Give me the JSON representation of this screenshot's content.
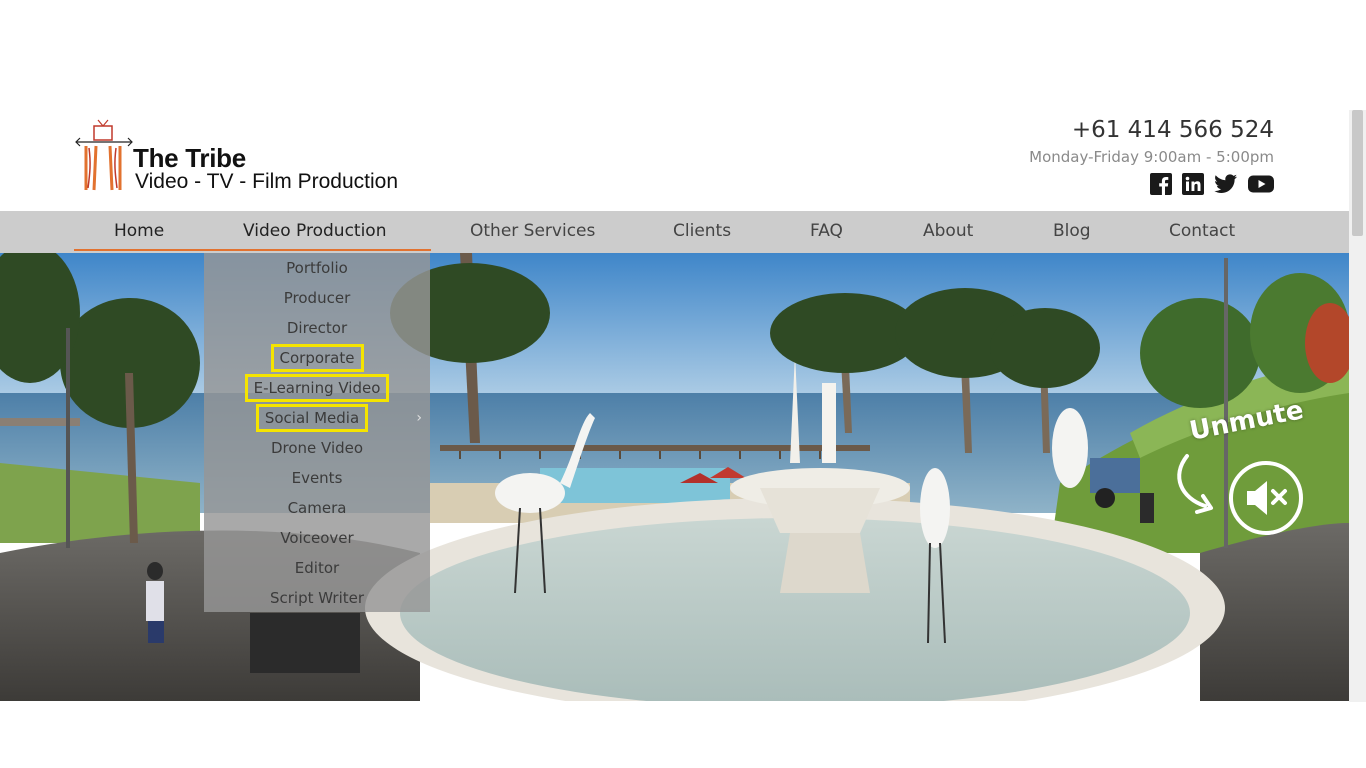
{
  "brand": {
    "title": "The Tribe",
    "subtitle": "Video - TV - Film Production"
  },
  "contact": {
    "phone": "+61 414 566 524",
    "hours": "Monday-Friday  9:00am - 5:00pm"
  },
  "social": [
    "facebook-icon",
    "linkedin-icon",
    "twitter-icon",
    "youtube-icon"
  ],
  "nav": {
    "items": [
      "Home",
      "Video Production",
      "Other Services",
      "Clients",
      "FAQ",
      "About",
      "Blog",
      "Contact"
    ],
    "active": "Video Production"
  },
  "dropdown": {
    "items": [
      "Portfolio",
      "Producer",
      "Director",
      "Corporate",
      "E-Learning Video",
      "Social Media",
      "Drone Video",
      "Events",
      "Camera",
      "Voiceover",
      "Editor",
      "Script Writer"
    ],
    "highlighted": [
      "Corporate",
      "E-Learning Video",
      "Social Media"
    ],
    "submenu_arrow": "›"
  },
  "hero": {
    "unmute_label": "Unmute"
  },
  "colors": {
    "accent": "#e2722f",
    "nav_bg": "#cccccc",
    "highlight": "#f5e400"
  }
}
